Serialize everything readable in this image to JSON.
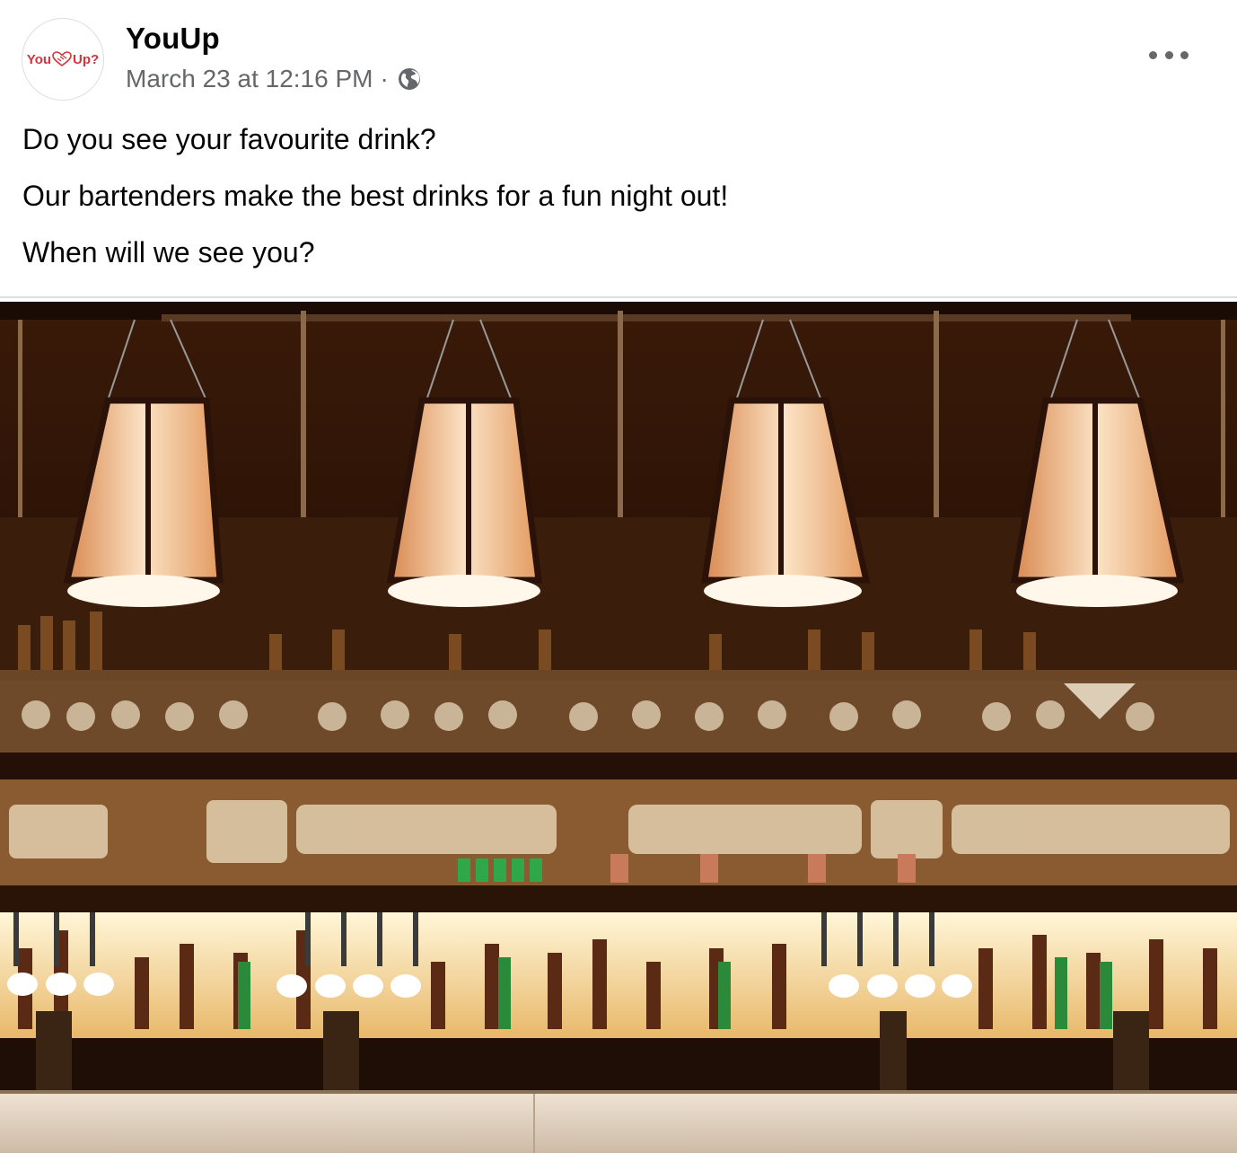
{
  "post": {
    "page_name": "YouUp",
    "timestamp": "March 23 at 12:16 PM",
    "separator": "·",
    "privacy_icon": "globe-icon",
    "more_icon": "more-options-icon",
    "lines": [
      "Do you see your favourite drink?",
      "Our bartenders make the best drinks for a fun night out!",
      "When will we see you?"
    ]
  },
  "logo": {
    "left": "You",
    "right": "Up?",
    "color": "#d6333d"
  },
  "colors": {
    "text_primary": "#050505",
    "text_secondary": "#65676b",
    "divider": "#dadde1"
  }
}
